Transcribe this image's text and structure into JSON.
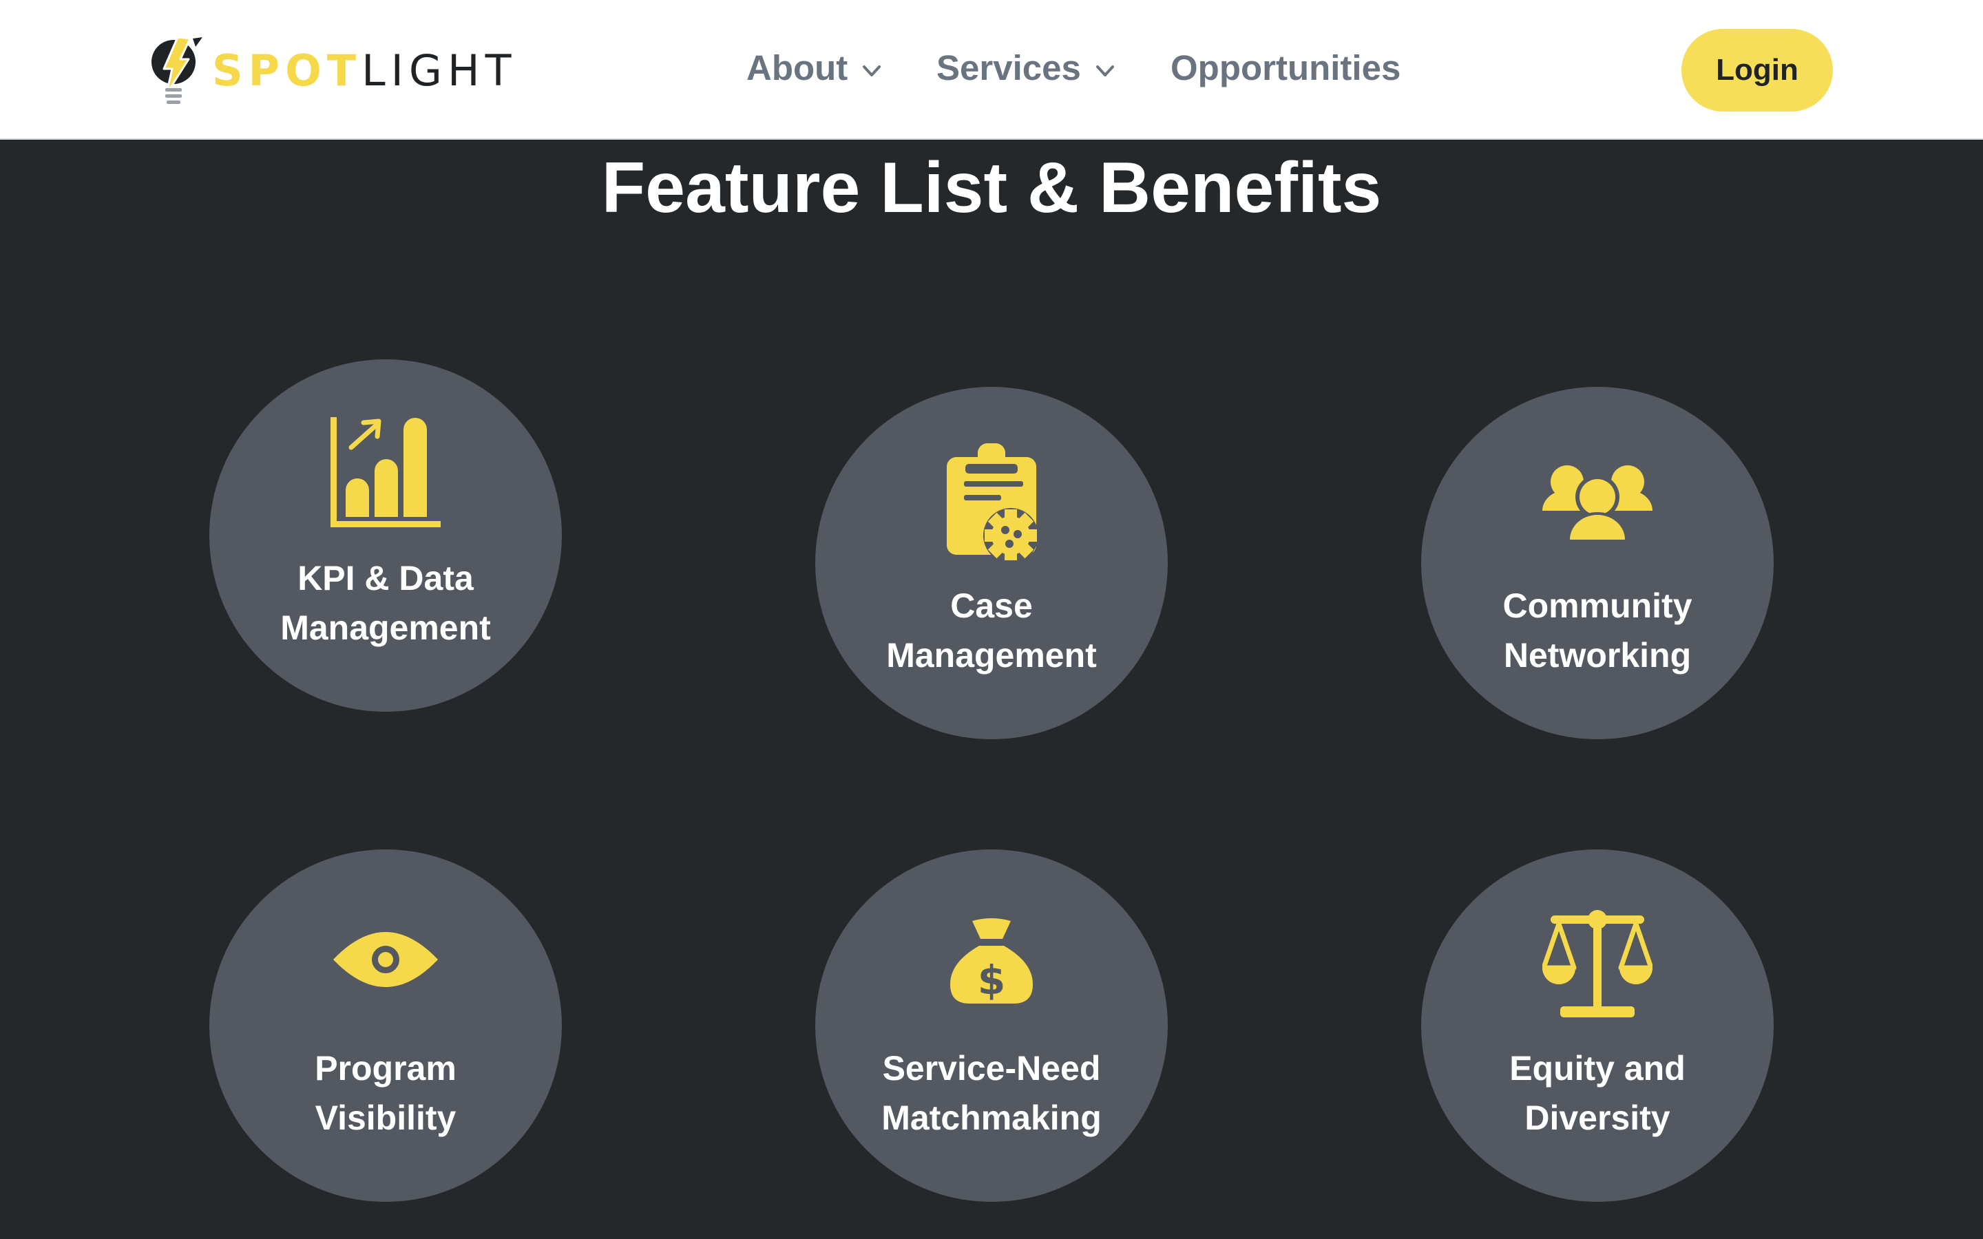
{
  "header": {
    "logo": {
      "part1": "SPOT",
      "part2": "LIGHT",
      "icon": "lightbulb-bolt-icon"
    },
    "nav": [
      {
        "label": "About",
        "has_dropdown": true
      },
      {
        "label": "Services",
        "has_dropdown": true
      },
      {
        "label": "Opportunities",
        "has_dropdown": false
      }
    ],
    "login_label": "Login"
  },
  "section": {
    "title": "Feature List & Benefits",
    "features": [
      {
        "line1": "KPI & Data",
        "line2": "Management",
        "icon": "bar-chart-growth-icon"
      },
      {
        "line1": "Case",
        "line2": "Management",
        "icon": "clipboard-gear-icon"
      },
      {
        "line1": "Community",
        "line2": "Networking",
        "icon": "users-group-icon"
      },
      {
        "line1": "Program",
        "line2": "Visibility",
        "icon": "eye-icon"
      },
      {
        "line1": "Service-Need",
        "line2": "Matchmaking",
        "icon": "money-bag-icon"
      },
      {
        "line1": "Equity and",
        "line2": "Diversity",
        "icon": "balance-scale-icon"
      }
    ]
  },
  "colors": {
    "accent": "#f6d94a",
    "background": "#25282b",
    "circle": "#545961",
    "nav_text": "#6a7480",
    "header_bg": "#ffffff"
  }
}
